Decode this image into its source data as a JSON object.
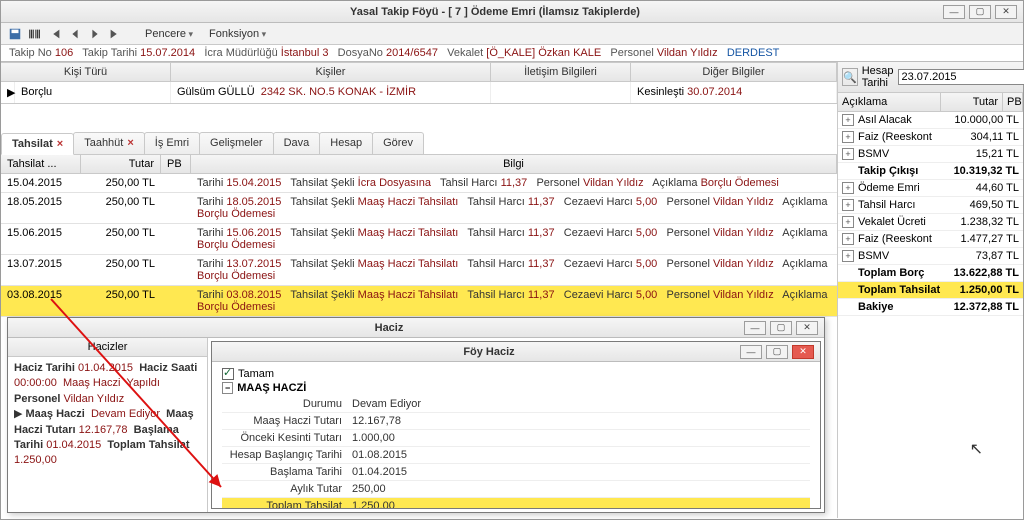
{
  "window": {
    "title": "Yasal Takip Föyü - [ 7 ] Ödeme Emri (İlamsız Takiplerde)",
    "min": "—",
    "max": "▢",
    "close": "✕",
    "menu": {
      "pencere": "Pencere",
      "fonksiyon": "Fonksiyon"
    }
  },
  "info": {
    "takipNoLbl": "Takip No",
    "takipNo": "106",
    "takipTarihiLbl": "Takip Tarihi",
    "takipTarihi": "15.07.2014",
    "icraLbl": "İcra Müdürlüğü",
    "icra": "İstanbul 3",
    "dosyaNoLbl": "DosyaNo",
    "dosyaNo": "2014/6547",
    "vekaletLbl": "Vekalet",
    "vekalet": "[Ö_KALE] Özkan KALE",
    "personelLbl": "Personel",
    "personel": "Vildan Yıldız",
    "derdest": "DERDEST"
  },
  "partyHeaders": {
    "c0": "Kişi Türü",
    "c1": "Kişiler",
    "c2": "İletişim Bilgileri",
    "c3": "Diğer Bilgiler"
  },
  "partyRow": {
    "tur": "Borçlu",
    "ad": "Gülsüm GÜLLÜ",
    "adres": "2342 SK. NO.5   KONAK   - İZMİR",
    "iletisim": "",
    "kesinLbl": "Kesinleşti",
    "kesin": "30.07.2014"
  },
  "tabs": {
    "tahsilat": "Tahsilat",
    "taahhut": "Taahhüt",
    "isemri": "İş Emri",
    "gelismeler": "Gelişmeler",
    "dava": "Dava",
    "hesap": "Hesap",
    "gorev": "Görev"
  },
  "subhead": {
    "c0": "Tahsilat ...",
    "c1": "Tutar",
    "c2": "PB",
    "c3": "Bilgi"
  },
  "rows": [
    {
      "tarih": "15.04.2015",
      "tutar": "250,00 TL",
      "b_tarih": "15.04.2015",
      "sekli": "İcra Dosyasına",
      "tharc": "11,37",
      "charc": "",
      "pers": "Vildan Yıldız",
      "acik": "Borçlu Ödemesi"
    },
    {
      "tarih": "18.05.2015",
      "tutar": "250,00 TL",
      "b_tarih": "18.05.2015",
      "sekli": "Maaş Haczi Tahsilatı",
      "tharc": "11,37",
      "charc": "5,00",
      "pers": "Vildan Yıldız",
      "acik": "Borçlu Ödemesi"
    },
    {
      "tarih": "15.06.2015",
      "tutar": "250,00 TL",
      "b_tarih": "15.06.2015",
      "sekli": "Maaş Haczi Tahsilatı",
      "tharc": "11,37",
      "charc": "5,00",
      "pers": "Vildan Yıldız",
      "acik": "Borçlu Ödemesi"
    },
    {
      "tarih": "13.07.2015",
      "tutar": "250,00 TL",
      "b_tarih": "13.07.2015",
      "sekli": "Maaş Haczi Tahsilatı",
      "tharc": "11,37",
      "charc": "5,00",
      "pers": "Vildan Yıldız",
      "acik": "Borçlu Ödemesi"
    },
    {
      "tarih": "03.08.2015",
      "tutar": "250,00 TL",
      "b_tarih": "03.08.2015",
      "sekli": "Maaş Haczi Tahsilatı",
      "tharc": "11,37",
      "charc": "5,00",
      "pers": "Vildan Yıldız",
      "acik": "Borçlu Ödemesi",
      "hl": true
    }
  ],
  "bilgiLabels": {
    "tarih": "Tarihi",
    "sekli": "Tahsilat Şekli",
    "tharc": "Tahsil Harcı",
    "charc": "Cezaevi Harcı",
    "pers": "Personel",
    "acik": "Açıklama"
  },
  "right": {
    "hesapTarihiLbl": "Hesap Tarihi",
    "hesapTarihi": "23.07.2015",
    "hdr": {
      "aciklama": "Açıklama",
      "tutar": "Tutar",
      "pb": "PB"
    },
    "items": [
      {
        "plus": true,
        "name": "Asıl Alacak",
        "val": "10.000,00 TL"
      },
      {
        "plus": true,
        "name": "Faiz (Reeskont",
        "val": "304,11 TL"
      },
      {
        "plus": true,
        "name": "BSMV",
        "val": "15,21 TL"
      },
      {
        "strong": true,
        "name": "Takip Çıkışı",
        "val": "10.319,32 TL"
      },
      {
        "plus": true,
        "name": "Ödeme Emri",
        "val": "44,60 TL"
      },
      {
        "plus": true,
        "name": "Tahsil Harcı",
        "val": "469,50 TL"
      },
      {
        "plus": true,
        "name": "Vekalet Ücreti",
        "val": "1.238,32 TL"
      },
      {
        "plus": true,
        "name": "Faiz (Reeskont",
        "val": "1.477,27 TL"
      },
      {
        "plus": true,
        "name": "BSMV",
        "val": "73,87 TL"
      },
      {
        "strong": true,
        "name": "Toplam Borç",
        "val": "13.622,88 TL"
      },
      {
        "hl": true,
        "strong": true,
        "name": "Toplam Tahsilat",
        "val": "1.250,00 TL"
      },
      {
        "strong": true,
        "name": "Bakiye",
        "val": "12.372,88 TL"
      }
    ]
  },
  "haciz": {
    "title": "Haciz",
    "left": {
      "head": "Hacizler",
      "l1a": "Haciz Tarihi",
      "l1av": "01.04.2015",
      "l1b": "Haciz Saati",
      "l1bv": "00:00:00",
      "l2a": "Maaş Haczi",
      "l2b": "Yapıldı",
      "l3a": "Personel",
      "l3b": "Vildan Yıldız",
      "l4a": "Maaş Haczi",
      "l4b": "Devam Ediyor",
      "l4c": "Maaş",
      "l5a": "Haczi Tutarı",
      "l5b": "12.167,78",
      "l5c": "Başlama",
      "l6a": "Tarihi",
      "l6b": "01.04.2015",
      "l6c": "Toplam Tahsilat",
      "l7": "1.250,00"
    }
  },
  "foy": {
    "title": "Föy Haciz",
    "tamam": "Tamam",
    "maasHead": "MAAŞ HACZİ",
    "rows": [
      {
        "l": "Durumu",
        "v": "Devam Ediyor"
      },
      {
        "l": "Maaş Haczi Tutarı",
        "v": "12.167,78"
      },
      {
        "l": "Önceki Kesinti Tutarı",
        "v": "1.000,00"
      },
      {
        "l": "Hesap Başlangıç Tarihi",
        "v": "01.08.2015"
      },
      {
        "l": "Başlama Tarihi",
        "v": "01.04.2015"
      },
      {
        "l": "Aylık Tutar",
        "v": "250,00"
      },
      {
        "l": "Toplam Tahsilat",
        "v": "1.250,00",
        "hl": true
      }
    ]
  }
}
